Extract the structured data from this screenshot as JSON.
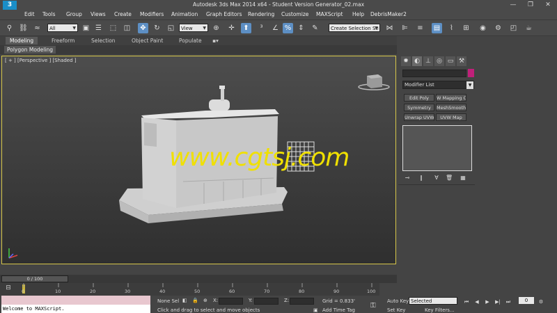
{
  "titlebar": {
    "title": "Autodesk 3ds Max  2014 x64    - Student Version    Generator_02.max",
    "minimize": "—",
    "maximize": "❐",
    "close": "✕"
  },
  "menu": [
    "Edit",
    "Tools",
    "Group",
    "Views",
    "Create",
    "Modifiers",
    "Animation",
    "Graph Editors",
    "Rendering",
    "Customize",
    "MAXScript",
    "Help",
    "DebrisMaker2"
  ],
  "toolbar": {
    "selection_filter": "All",
    "reference_coord": "View",
    "named_selection": "Create Selection Se"
  },
  "ribbon": {
    "tabs": [
      "Modeling",
      "Freeform",
      "Selection",
      "Object Paint",
      "Populate"
    ],
    "active_tab": "Modeling",
    "sub_label": "Polygon Modeling"
  },
  "viewport": {
    "label": "[ + ] [Perspective ] [Shaded ]",
    "watermark": "www.cgtsj.com"
  },
  "command_panel": {
    "modifier_list": "Modifier List",
    "buttons": [
      "Edit Poly",
      "W Mapping Cl",
      "Symmetry",
      "MeshSmooth",
      "Unwrap UVW",
      "UVW Map"
    ]
  },
  "timeline": {
    "slider": "0 / 100",
    "ticks": [
      "0",
      "10",
      "20",
      "30",
      "40",
      "50",
      "60",
      "70",
      "80",
      "90",
      "100"
    ]
  },
  "status": {
    "listener": "Welcome to MAXScript.",
    "selected_count": "None Sel",
    "x_label": "X:",
    "y_label": "Y:",
    "z_label": "Z:",
    "grid": "Grid = 0.833'",
    "prompt": "Click and drag to select and move objects",
    "add_time_tag": "Add Time Tag",
    "auto_key": "Auto Key",
    "set_key": "Set Key",
    "selected_dropdown": "Selected",
    "key_filters": "Key Filters...",
    "frame": "0"
  },
  "colors": {
    "accent": "#5d8fc4",
    "viewport_border": "#d8c84a",
    "watermark": "#f0e000",
    "object_color": "#c0207a"
  }
}
